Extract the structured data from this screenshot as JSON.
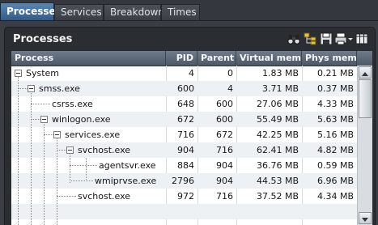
{
  "tabs": [
    {
      "label": "Processes"
    },
    {
      "label": "Services"
    },
    {
      "label": "Breakdown"
    },
    {
      "label": "Times"
    }
  ],
  "panel": {
    "title": "Processes",
    "toolbar_icons": [
      "binoculars-icon",
      "hierarchy-icon",
      "save-icon",
      "print-icon",
      "dropdown-arrow-icon",
      "columns-icon"
    ]
  },
  "table": {
    "columns": [
      "Process",
      "PID",
      "Parent",
      "Virtual mem",
      "Phys mem"
    ],
    "rows": [
      {
        "process": "System",
        "pid": "4",
        "parent": "0",
        "virtual_mem": "1.83 MB",
        "phys_mem": "0.21 MB"
      },
      {
        "process": "smss.exe",
        "pid": "600",
        "parent": "4",
        "virtual_mem": "3.71 MB",
        "phys_mem": "0.37 MB"
      },
      {
        "process": "csrss.exe",
        "pid": "648",
        "parent": "600",
        "virtual_mem": "27.06 MB",
        "phys_mem": "4.33 MB"
      },
      {
        "process": "winlogon.exe",
        "pid": "672",
        "parent": "600",
        "virtual_mem": "55.49 MB",
        "phys_mem": "5.63 MB"
      },
      {
        "process": "services.exe",
        "pid": "716",
        "parent": "672",
        "virtual_mem": "42.25 MB",
        "phys_mem": "5.16 MB"
      },
      {
        "process": "svchost.exe",
        "pid": "904",
        "parent": "716",
        "virtual_mem": "62.41 MB",
        "phys_mem": "4.82 MB"
      },
      {
        "process": "agentsvr.exe",
        "pid": "884",
        "parent": "904",
        "virtual_mem": "36.76 MB",
        "phys_mem": "0.59 MB"
      },
      {
        "process": "wmiprvse.exe",
        "pid": "2796",
        "parent": "904",
        "virtual_mem": "44.53 MB",
        "phys_mem": "6.96 MB"
      },
      {
        "process": "svchost.exe",
        "pid": "972",
        "parent": "716",
        "virtual_mem": "37.52 MB",
        "phys_mem": "4.34 MB"
      }
    ]
  },
  "colors": {
    "accent_tab": "#3f6e9f",
    "header": "#5c6777",
    "alt_row": "#eef1f4"
  }
}
